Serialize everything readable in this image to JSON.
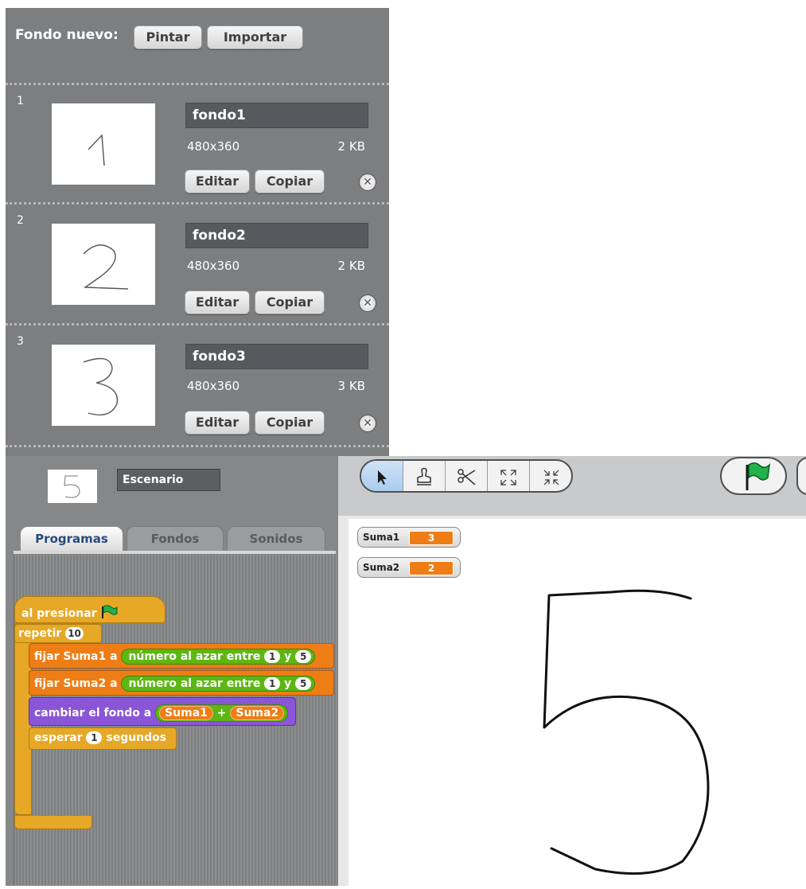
{
  "backgrounds_panel": {
    "new_background_label": "Fondo nuevo:",
    "paint_button": "Pintar",
    "import_button": "Importar",
    "items": [
      {
        "number": "1",
        "name": "fondo1",
        "dimensions": "480x360",
        "size": "2 KB",
        "thumbnail_glyph": "1",
        "edit_button": "Editar",
        "copy_button": "Copiar",
        "delete_icon": "x-close-icon"
      },
      {
        "number": "2",
        "name": "fondo2",
        "dimensions": "480x360",
        "size": "2 KB",
        "thumbnail_glyph": "2",
        "edit_button": "Editar",
        "copy_button": "Copiar",
        "delete_icon": "x-close-icon"
      },
      {
        "number": "3",
        "name": "fondo3",
        "dimensions": "480x360",
        "size": "3 KB",
        "thumbnail_glyph": "3",
        "edit_button": "Editar",
        "copy_button": "Copiar",
        "delete_icon": "x-close-icon"
      }
    ]
  },
  "sprite_info": {
    "thumbnail_glyph": "5",
    "name": "Escenario"
  },
  "tabs": [
    {
      "label": "Programas",
      "active": true
    },
    {
      "label": "Fondos",
      "active": false
    },
    {
      "label": "Sonidos",
      "active": false
    }
  ],
  "script": {
    "hat": "al presionar",
    "repeat_label": "repetir",
    "repeat_count": "10",
    "set1_prefix": "fijar Suma1 a",
    "set2_prefix": "fijar Suma2 a",
    "random_label": "número al azar entre",
    "random_and": "y",
    "random_from": "1",
    "random_to": "5",
    "switch_label": "cambiar el fondo a",
    "var1": "Suma1",
    "plus": "+",
    "var2": "Suma2",
    "wait_label": "esperar",
    "wait_value": "1",
    "wait_unit": "segundos"
  },
  "toolbar": {
    "tools": [
      "pointer-icon",
      "stamp-icon",
      "scissors-icon",
      "grow-icon",
      "shrink-icon"
    ],
    "green_flag": "green-flag-icon"
  },
  "monitors": [
    {
      "name": "Suma1",
      "value": "3"
    },
    {
      "name": "Suma2",
      "value": "2"
    }
  ],
  "stage": {
    "displayed_glyph": "5"
  },
  "colors": {
    "control": "#e6a826",
    "variables": "#ee7d16",
    "looks": "#8a55d7",
    "operators": "#5cb712",
    "flag_green": "#22b14c"
  }
}
